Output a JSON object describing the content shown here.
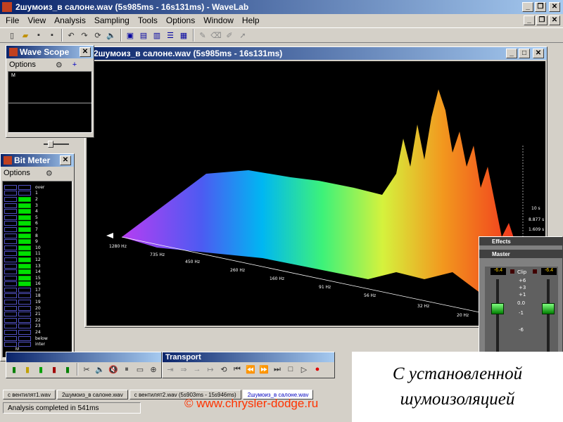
{
  "app": {
    "title": "2шумоиз_в салоне.wav (5s985ms - 16s131ms) - WaveLab"
  },
  "menu": [
    "File",
    "View",
    "Analysis",
    "Sampling",
    "Tools",
    "Options",
    "Window",
    "Help"
  ],
  "toolbar_icons": [
    "new-file-icon",
    "open-file-icon",
    "save-icon",
    "save-all-icon",
    "undo-icon",
    "redo-icon",
    "loop-icon",
    "speaker-icon",
    "window-icon",
    "waveform-icon",
    "split-icon",
    "list-icon",
    "tile-icon",
    "pencil-icon",
    "eraser-icon",
    "brush-icon",
    "cursor-icon"
  ],
  "wave_scope": {
    "title": "Wave Scope",
    "options": "Options",
    "marker": "M"
  },
  "bit_meter": {
    "title": "Bit Meter",
    "options": "Options",
    "labels": [
      "over",
      "1",
      "2",
      "3",
      "4",
      "5",
      "6",
      "7",
      "8",
      "9",
      "10",
      "11",
      "12",
      "13",
      "14",
      "15",
      "16",
      "17",
      "18",
      "19",
      "20",
      "21",
      "22",
      "23",
      "24",
      "below",
      "inter"
    ],
    "active_from": 2,
    "active_to": 16,
    "marker": "M"
  },
  "doc_window": {
    "title": "2шумоиз_в салоне.wav (5s985ms - 16s131ms)"
  },
  "spectrum": {
    "freq_labels": [
      "1280 Hz",
      "735 Hz",
      "450 Hz",
      "260 Hz",
      "160 Hz",
      "91 Hz",
      "56 Hz",
      "32 Hz",
      "20 Hz"
    ],
    "time_labels": [
      "10 s",
      "8.877 s",
      "1.609 s"
    ]
  },
  "mixer": {
    "effects": "Effects",
    "master": "Master",
    "left_level": "-6.4",
    "right_level": "-6.4",
    "clip": "Clip",
    "scale": [
      "+6",
      "+3",
      "+1",
      "0.0",
      "-1",
      "-6"
    ]
  },
  "transport": {
    "title": "Transport"
  },
  "tabs": [
    "с вентилят1.wav",
    "2шумоиз_в салоне.wav",
    "с вентилят2.wav (5s903ms - 15s946ms)",
    "2шумоиз_в салоне.wav"
  ],
  "status": {
    "text": "Analysis completed in 541ms"
  },
  "watermark": "© www.chrysler-dodge.ru",
  "caption": {
    "line1": "С установленной",
    "line2": "шумоизоляцией"
  },
  "colors": {
    "title_bar": "#0a246a",
    "meter_on": "#00e000",
    "watermark": "#ff3300"
  }
}
